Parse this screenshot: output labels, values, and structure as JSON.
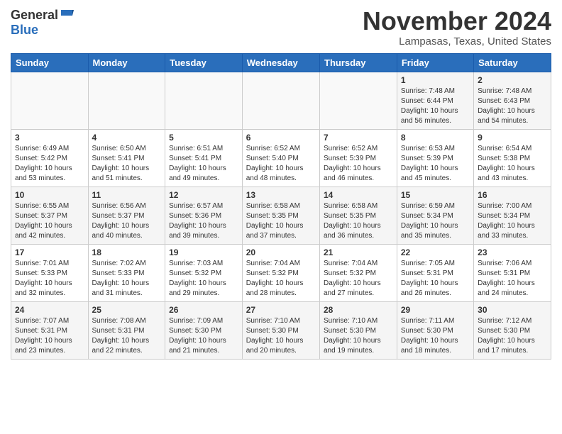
{
  "header": {
    "logo_general": "General",
    "logo_blue": "Blue",
    "month": "November 2024",
    "location": "Lampasas, Texas, United States"
  },
  "weekdays": [
    "Sunday",
    "Monday",
    "Tuesday",
    "Wednesday",
    "Thursday",
    "Friday",
    "Saturday"
  ],
  "weeks": [
    [
      {
        "day": "",
        "info": ""
      },
      {
        "day": "",
        "info": ""
      },
      {
        "day": "",
        "info": ""
      },
      {
        "day": "",
        "info": ""
      },
      {
        "day": "",
        "info": ""
      },
      {
        "day": "1",
        "info": "Sunrise: 7:48 AM\nSunset: 6:44 PM\nDaylight: 10 hours and 56 minutes."
      },
      {
        "day": "2",
        "info": "Sunrise: 7:48 AM\nSunset: 6:43 PM\nDaylight: 10 hours and 54 minutes."
      }
    ],
    [
      {
        "day": "3",
        "info": "Sunrise: 6:49 AM\nSunset: 5:42 PM\nDaylight: 10 hours and 53 minutes."
      },
      {
        "day": "4",
        "info": "Sunrise: 6:50 AM\nSunset: 5:41 PM\nDaylight: 10 hours and 51 minutes."
      },
      {
        "day": "5",
        "info": "Sunrise: 6:51 AM\nSunset: 5:41 PM\nDaylight: 10 hours and 49 minutes."
      },
      {
        "day": "6",
        "info": "Sunrise: 6:52 AM\nSunset: 5:40 PM\nDaylight: 10 hours and 48 minutes."
      },
      {
        "day": "7",
        "info": "Sunrise: 6:52 AM\nSunset: 5:39 PM\nDaylight: 10 hours and 46 minutes."
      },
      {
        "day": "8",
        "info": "Sunrise: 6:53 AM\nSunset: 5:39 PM\nDaylight: 10 hours and 45 minutes."
      },
      {
        "day": "9",
        "info": "Sunrise: 6:54 AM\nSunset: 5:38 PM\nDaylight: 10 hours and 43 minutes."
      }
    ],
    [
      {
        "day": "10",
        "info": "Sunrise: 6:55 AM\nSunset: 5:37 PM\nDaylight: 10 hours and 42 minutes."
      },
      {
        "day": "11",
        "info": "Sunrise: 6:56 AM\nSunset: 5:37 PM\nDaylight: 10 hours and 40 minutes."
      },
      {
        "day": "12",
        "info": "Sunrise: 6:57 AM\nSunset: 5:36 PM\nDaylight: 10 hours and 39 minutes."
      },
      {
        "day": "13",
        "info": "Sunrise: 6:58 AM\nSunset: 5:35 PM\nDaylight: 10 hours and 37 minutes."
      },
      {
        "day": "14",
        "info": "Sunrise: 6:58 AM\nSunset: 5:35 PM\nDaylight: 10 hours and 36 minutes."
      },
      {
        "day": "15",
        "info": "Sunrise: 6:59 AM\nSunset: 5:34 PM\nDaylight: 10 hours and 35 minutes."
      },
      {
        "day": "16",
        "info": "Sunrise: 7:00 AM\nSunset: 5:34 PM\nDaylight: 10 hours and 33 minutes."
      }
    ],
    [
      {
        "day": "17",
        "info": "Sunrise: 7:01 AM\nSunset: 5:33 PM\nDaylight: 10 hours and 32 minutes."
      },
      {
        "day": "18",
        "info": "Sunrise: 7:02 AM\nSunset: 5:33 PM\nDaylight: 10 hours and 31 minutes."
      },
      {
        "day": "19",
        "info": "Sunrise: 7:03 AM\nSunset: 5:32 PM\nDaylight: 10 hours and 29 minutes."
      },
      {
        "day": "20",
        "info": "Sunrise: 7:04 AM\nSunset: 5:32 PM\nDaylight: 10 hours and 28 minutes."
      },
      {
        "day": "21",
        "info": "Sunrise: 7:04 AM\nSunset: 5:32 PM\nDaylight: 10 hours and 27 minutes."
      },
      {
        "day": "22",
        "info": "Sunrise: 7:05 AM\nSunset: 5:31 PM\nDaylight: 10 hours and 26 minutes."
      },
      {
        "day": "23",
        "info": "Sunrise: 7:06 AM\nSunset: 5:31 PM\nDaylight: 10 hours and 24 minutes."
      }
    ],
    [
      {
        "day": "24",
        "info": "Sunrise: 7:07 AM\nSunset: 5:31 PM\nDaylight: 10 hours and 23 minutes."
      },
      {
        "day": "25",
        "info": "Sunrise: 7:08 AM\nSunset: 5:31 PM\nDaylight: 10 hours and 22 minutes."
      },
      {
        "day": "26",
        "info": "Sunrise: 7:09 AM\nSunset: 5:30 PM\nDaylight: 10 hours and 21 minutes."
      },
      {
        "day": "27",
        "info": "Sunrise: 7:10 AM\nSunset: 5:30 PM\nDaylight: 10 hours and 20 minutes."
      },
      {
        "day": "28",
        "info": "Sunrise: 7:10 AM\nSunset: 5:30 PM\nDaylight: 10 hours and 19 minutes."
      },
      {
        "day": "29",
        "info": "Sunrise: 7:11 AM\nSunset: 5:30 PM\nDaylight: 10 hours and 18 minutes."
      },
      {
        "day": "30",
        "info": "Sunrise: 7:12 AM\nSunset: 5:30 PM\nDaylight: 10 hours and 17 minutes."
      }
    ]
  ]
}
